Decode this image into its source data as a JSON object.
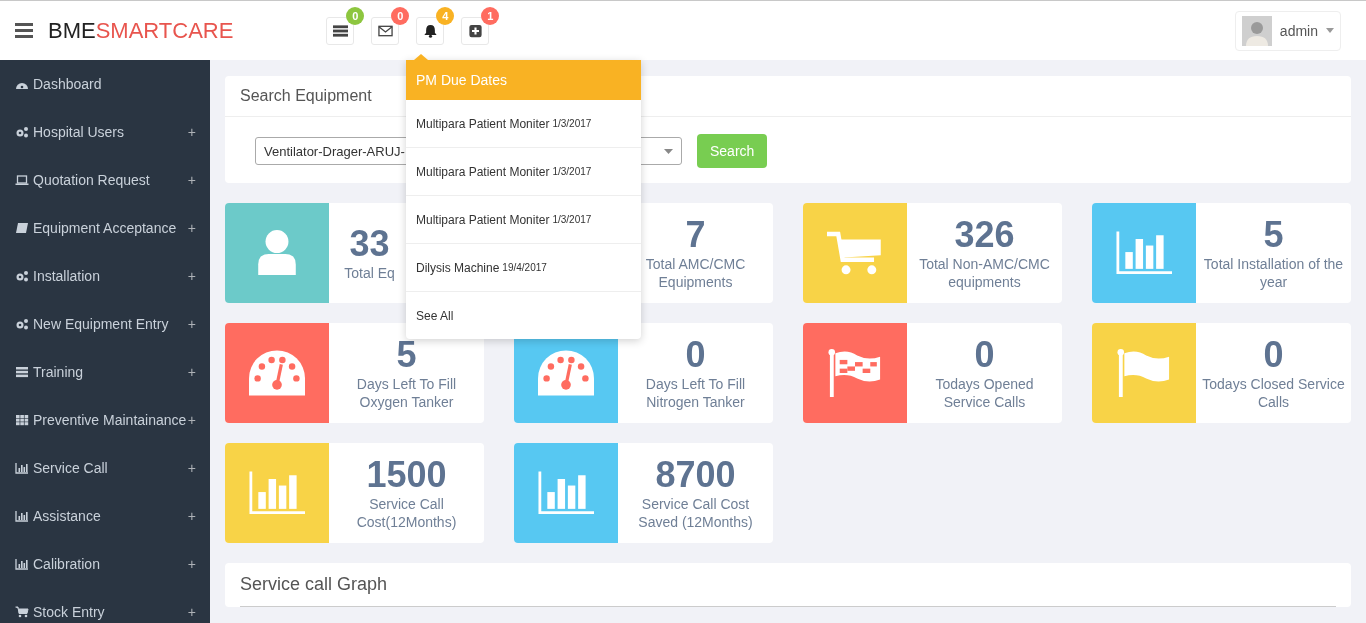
{
  "header": {
    "brand_dark": "BME",
    "brand_accent": "SMARTCARE",
    "icons": [
      {
        "kind": "tasks",
        "badge": "0",
        "color": "#8dc63f"
      },
      {
        "kind": "mail",
        "badge": "0",
        "color": "#ff6c60"
      },
      {
        "kind": "bell",
        "badge": "4",
        "color": "#f9b223"
      },
      {
        "kind": "plus",
        "badge": "1",
        "color": "#ff6c60"
      }
    ],
    "user": {
      "name": "admin"
    }
  },
  "sidebar": {
    "items": [
      {
        "kind": "gauge",
        "label": "Dashboard"
      },
      {
        "kind": "cogs",
        "label": "Hospital Users",
        "toggle": "+"
      },
      {
        "kind": "laptop",
        "label": "Quotation Request",
        "toggle": "+"
      },
      {
        "kind": "book",
        "label": "Equipment Acceptance",
        "toggle": "+"
      },
      {
        "kind": "cogs",
        "label": "Installation",
        "toggle": "+"
      },
      {
        "kind": "cogs",
        "label": "New Equipment Entry",
        "toggle": "+"
      },
      {
        "kind": "tasks",
        "label": "Training",
        "toggle": "+"
      },
      {
        "kind": "grid",
        "label": "Preventive Maintainance",
        "toggle": "+"
      },
      {
        "kind": "chart",
        "label": "Service Call",
        "toggle": "+"
      },
      {
        "kind": "chart",
        "label": "Assistance",
        "toggle": "+"
      },
      {
        "kind": "chart",
        "label": "Calibration",
        "toggle": "+"
      },
      {
        "kind": "cart",
        "label": "Stock Entry",
        "toggle": "+"
      }
    ]
  },
  "search_panel": {
    "title": "Search Equipment",
    "select_value": "Ventilator-Drager-ARUJ-",
    "button": "Search"
  },
  "dropdown": {
    "title": "PM Due Dates",
    "items": [
      {
        "name": "Multipara Patient Moniter",
        "date": "1/3/2017"
      },
      {
        "name": "Multipara Patient Moniter",
        "date": "1/3/2017"
      },
      {
        "name": "Multipara Patient Moniter",
        "date": "1/3/2017"
      },
      {
        "name": "Dilysis Machine",
        "date": "19/4/2017"
      }
    ],
    "footer": "See All"
  },
  "cards": [
    {
      "kind": "user",
      "color": "#6ccac9",
      "value": "33",
      "label": "Total Eq",
      "clipped": true
    },
    {
      "kind": "hidden",
      "value": "7",
      "label": "Total AMC/CMC Equipments",
      "clipped": false
    },
    {
      "kind": "cart",
      "color": "#f8d347",
      "value": "326",
      "label": "Total Non-AMC/CMC equipments",
      "clipped": false
    },
    {
      "kind": "chart",
      "color": "#57c8f2",
      "value": "5",
      "label": "Total Installation of the year",
      "clipped": false
    },
    {
      "kind": "gauge",
      "color": "#ff6c60",
      "value": "5",
      "label": "Days Left To Fill Oxygen Tanker",
      "clipped": false
    },
    {
      "kind": "gauge",
      "color": "#57c8f2",
      "value": "0",
      "label": "Days Left To Fill Nitrogen Tanker",
      "clipped": false
    },
    {
      "kind": "checkered-flag",
      "color": "#ff6c60",
      "value": "0",
      "label": "Todays Opened Service Calls",
      "clipped": false
    },
    {
      "kind": "flag",
      "color": "#f8d347",
      "value": "0",
      "label": "Todays Closed Service Calls",
      "clipped": false
    },
    {
      "kind": "chart",
      "color": "#f8d347",
      "value": "1500",
      "label": "Service Call Cost(12Months)",
      "clipped": false
    },
    {
      "kind": "chart",
      "color": "#57c8f2",
      "value": "8700",
      "label": "Service Call Cost Saved (12Months)",
      "clipped": false
    }
  ],
  "graph_panel": {
    "title": "Service call Graph"
  }
}
